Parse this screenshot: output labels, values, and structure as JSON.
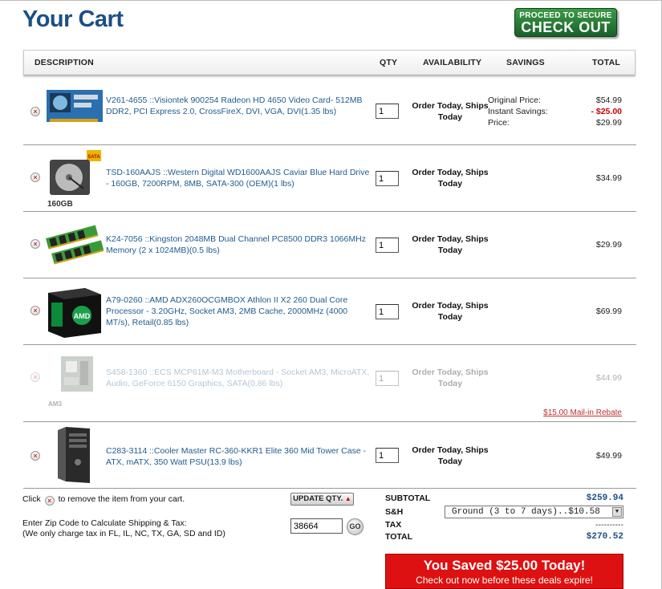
{
  "page_title": "Your Cart",
  "checkout_button": {
    "line1": "PROCEED TO SECURE",
    "line2": "CHECK OUT"
  },
  "columns": {
    "description": "DESCRIPTION",
    "qty": "QTY",
    "availability": "AVAILABILITY",
    "savings": "SAVINGS",
    "total": "TOTAL"
  },
  "items": [
    {
      "description": "V261-4655 ::Visiontek 900254 Radeon HD 4650 Video Card- 512MB DDR2, PCI Express 2.0, CrossFireX, DVI, VGA, DVI(1.35 lbs)",
      "qty": "1",
      "availability": "Order Today, Ships Today",
      "savings_labels": [
        "Original Price:",
        "Instant Savings:",
        "Price:"
      ],
      "totals": [
        "$54.99",
        "- $25.00",
        "$29.99"
      ]
    },
    {
      "description": "TSD-160AAJS ::Western Digital WD1600AAJS Caviar Blue Hard Drive - 160GB, 7200RPM, 8MB, SATA-300 (OEM)(1 lbs)",
      "qty": "1",
      "availability": "Order Today, Ships Today",
      "total": "$34.99",
      "thumb_caption": "160GB",
      "thumb_badge": "SATA"
    },
    {
      "description": "K24-7056 ::Kingston 2048MB Dual Channel PC8500 DDR3 1066MHz Memory (2 x 1024MB)(0.5 lbs)",
      "qty": "1",
      "availability": "Order Today, Ships Today",
      "total": "$29.99"
    },
    {
      "description": "A79-0260 ::AMD ADX260OCGMBOX Athlon II X2 260 Dual Core Processor - 3.20GHz, Socket AM3, 2MB Cache, 2000MHz (4000 MT/s), Retail(0.85 lbs)",
      "qty": "1",
      "availability": "Order Today, Ships Today",
      "total": "$69.99"
    },
    {
      "description": "S458-1360 ::ECS MCP61M-M3 Motherboard - Socket AM3, MicroATX, Audio, GeForce 6150 Graphics, SATA(0.86 lbs)",
      "qty": "1",
      "availability": "Order Today, Ships Today",
      "total": "$44.99",
      "rebate": "$15.00 Mail-in Rebate",
      "thumb_caption": "AM3"
    },
    {
      "description": "C283-3114 ::Cooler Master RC-360-KKR1 Elite 360 Mid Tower Case - ATX, mATX, 350 Watt PSU(13.9 lbs)",
      "qty": "1",
      "availability": "Order Today, Ships Today",
      "total": "$49.99"
    }
  ],
  "footer": {
    "remove_hint_pre": "Click",
    "remove_hint_post": "to remove the item from your cart.",
    "update_qty": "UPDATE QTY.",
    "zip_hint_line1": "Enter Zip Code to Calculate Shipping & Tax:",
    "zip_hint_line2": "(We only charge tax in FL, IL, NC, TX, GA, SD and ID)",
    "zip_value": "38664",
    "go": "GO"
  },
  "summary": {
    "subtotal_label": "SUBTOTAL",
    "subtotal": "$259.94",
    "sh_label": "S&H",
    "shipping_option": "Ground (3 to 7 days)..$10.58",
    "tax_label": "TAX",
    "tax": "----------",
    "total_label": "TOTAL",
    "total": "$270.52"
  },
  "savings_banner": {
    "headline": "You Saved $25.00 Today!",
    "subline": "Check out now before these deals expire!"
  },
  "colors": {
    "title_blue": "#1b4f86",
    "link_blue": "#1e5b90",
    "checkout_green": "#19612a",
    "banner_red": "#dd1111"
  }
}
